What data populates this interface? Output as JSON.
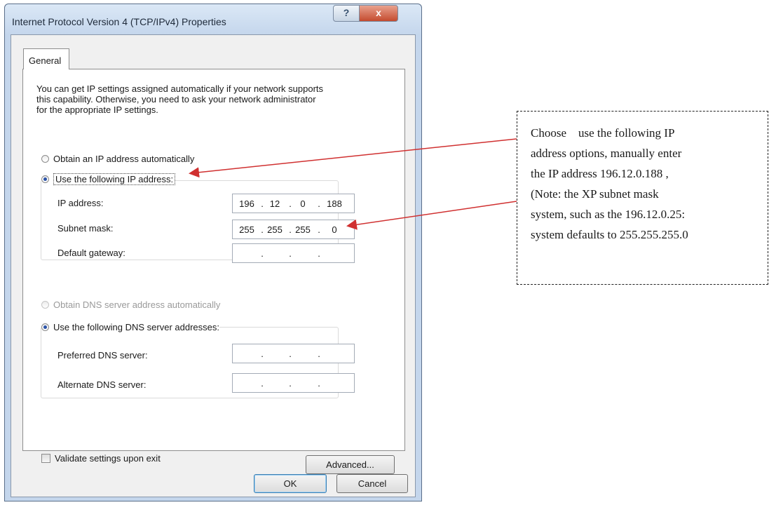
{
  "dialog": {
    "title": "Internet Protocol Version 4 (TCP/IPv4) Properties",
    "help_label": "?",
    "close_label": "x",
    "tab_general": "General",
    "description_lines": [
      "You can get IP settings assigned automatically if your network supports",
      "this capability. Otherwise, you need to ask your network administrator",
      "for the appropriate IP settings."
    ],
    "radio_obtain_ip": "Obtain an IP address automatically",
    "radio_use_ip": "Use the following IP address:",
    "ip_label": "IP address:",
    "ip_value": [
      "196",
      "12",
      "0",
      "188"
    ],
    "subnet_label": "Subnet mask:",
    "subnet_value": [
      "255",
      "255",
      "255",
      "0"
    ],
    "gateway_label": "Default gateway:",
    "radio_obtain_dns": "Obtain DNS server address automatically",
    "radio_use_dns": "Use the following DNS server addresses:",
    "preferred_dns_label": "Preferred DNS server:",
    "alternate_dns_label": "Alternate DNS server:",
    "validate_label": "Validate settings upon exit",
    "advanced_label": "Advanced...",
    "ok_label": "OK",
    "cancel_label": "Cancel",
    "ip_dot": "."
  },
  "callout": {
    "lines": [
      "Choose    use the following IP",
      "address options, manually enter",
      "the IP address 196.12.0.188 ,",
      "(Note: the XP subnet mask",
      "system, such as the 196.12.0.25:",
      "system defaults to 255.255.255.0"
    ]
  },
  "colors": {
    "title_bar": "#c4d6ec",
    "close_button": "#c44b2f",
    "radio_selected": "#2b53a8",
    "arrow": "#d03030"
  }
}
